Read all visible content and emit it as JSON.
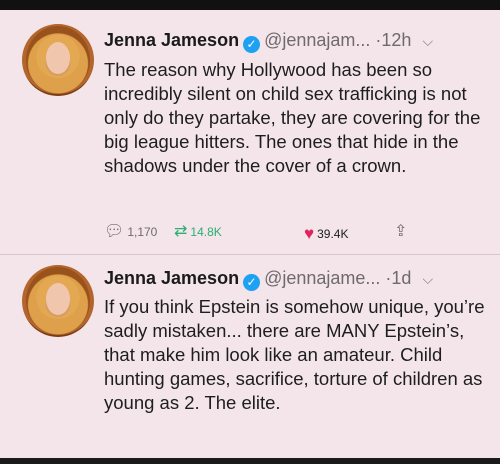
{
  "tweets": [
    {
      "author": "Jenna Jameson",
      "handle": "@jennajam...",
      "separator": "·",
      "time": "12h",
      "text": "The reason why Hollywood has been so incredibly silent on child sex trafficking is not only do they partake, they are covering for the big league hitters. The ones that hide in the shadows under the cover of a crown.",
      "replies": "1,170",
      "retweets": "14.8K",
      "likes": "39.4K"
    },
    {
      "author": "Jenna Jameson",
      "handle": "@jennajame...",
      "separator": "·",
      "time": "1d",
      "text": "If you think Epstein is somehow unique, you’re sadly mistaken... there are MANY Epstein’s, that make him look like an amateur. Child hunting games, sacrifice, torture of children as young as 2. The elite."
    }
  ],
  "icons": {
    "verified": "verified-badge-icon",
    "chevron": "chevron-down-icon",
    "reply": "reply-icon",
    "retweet": "retweet-icon",
    "like": "heart-icon",
    "share": "share-icon"
  },
  "colors": {
    "background": "#f3e5ea",
    "verified": "#1da1f2",
    "retweet": "#2bad73",
    "like": "#e0245e"
  }
}
